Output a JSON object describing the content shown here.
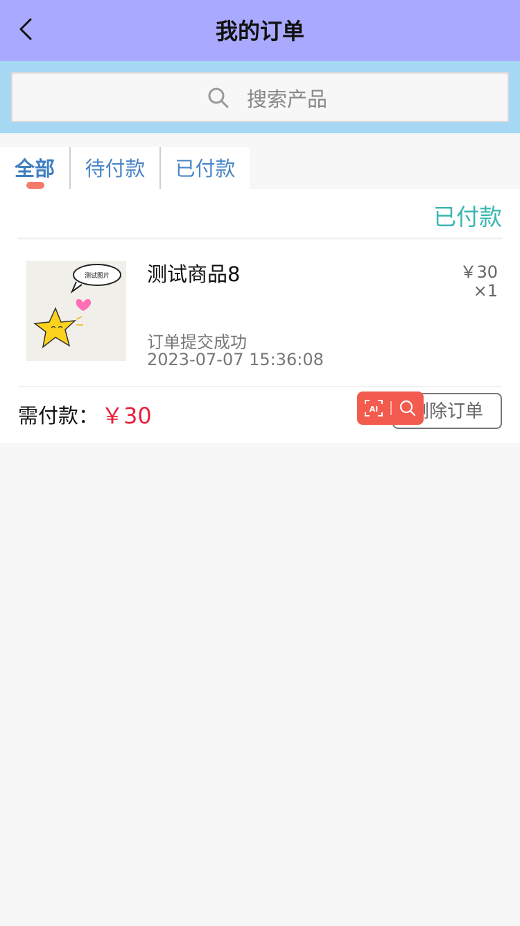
{
  "navbar": {
    "title": "我的订单",
    "back_icon": "chevron-left-icon"
  },
  "search": {
    "placeholder": "搜索产品",
    "icon": "search-icon"
  },
  "tabs": [
    {
      "label": "全部",
      "active": true
    },
    {
      "label": "待付款",
      "active": false
    },
    {
      "label": "已付款",
      "active": false
    }
  ],
  "colors": {
    "navbar_bg": "#a9a9ff",
    "search_bg": "#a6d8f3",
    "tab_text": "#4a86c5",
    "tab_indicator": "#f47a6a",
    "status": "#3ab7b0",
    "amount": "#e8203c",
    "toolbar": "#f25b4d"
  },
  "order": {
    "status": "已付款",
    "product_name": "测试商品8",
    "price": "￥30",
    "quantity": "×1",
    "thumbnail_caption": "测试图片",
    "message": "订单提交成功",
    "time": "2023-07-07 15:36:08",
    "pay_label": "需付款：",
    "pay_amount": "￥30",
    "delete_label": "删除订单"
  },
  "floating_toolbar": {
    "ai_icon": "ai-scan-icon",
    "lens_icon": "search-icon"
  }
}
